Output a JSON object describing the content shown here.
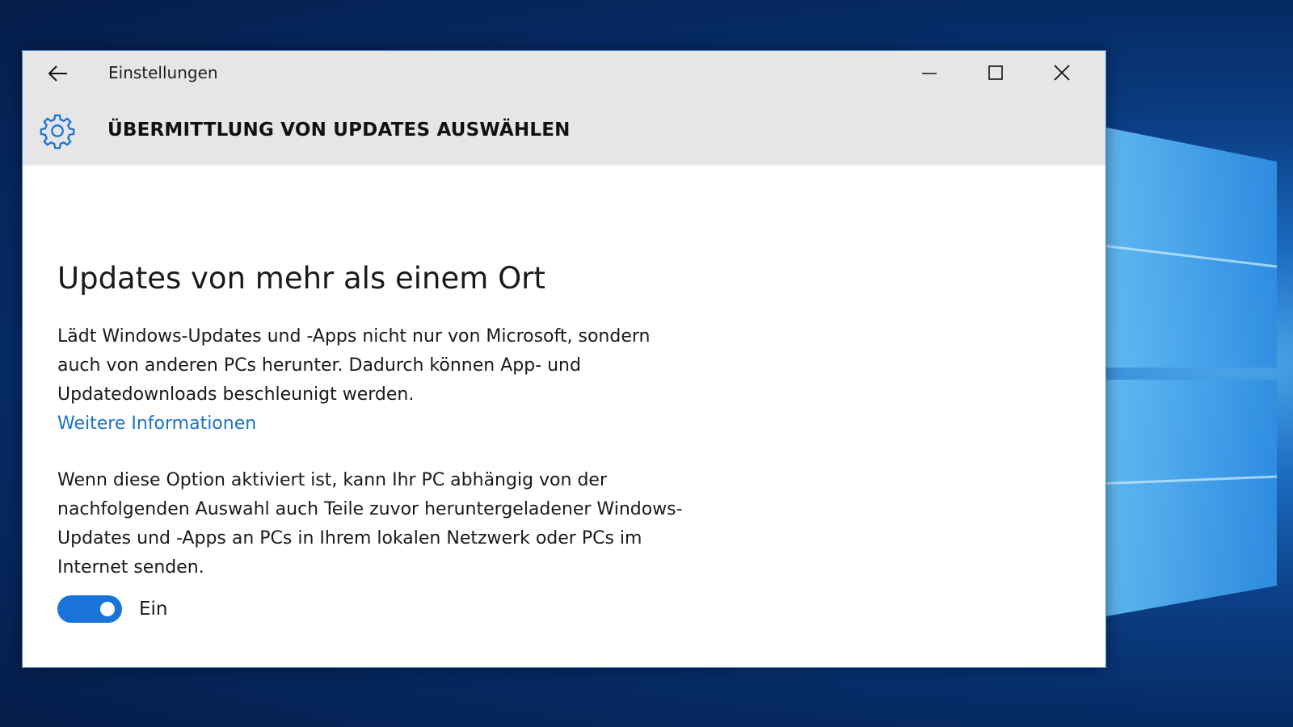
{
  "window": {
    "title": "Einstellungen",
    "page_title": "ÜBERMITTLUNG VON UPDATES AUSWÄHLEN"
  },
  "icons": {
    "back": "back-arrow-icon",
    "minimize": "minimize-icon",
    "maximize": "maximize-icon",
    "close": "close-icon",
    "settings": "gear-icon"
  },
  "content": {
    "heading": "Updates von mehr als einem Ort",
    "description": "Lädt Windows-Updates und -Apps nicht nur von Microsoft, sondern auch von anderen PCs herunter. Dadurch können App- und Updatedownloads beschleunigt werden.",
    "link": "Weitere Informationen",
    "option_text": "Wenn diese Option aktiviert ist, kann Ihr PC abhängig von der nachfolgenden Auswahl auch Teile zuvor heruntergeladener Windows-Updates und -Apps an PCs in Ihrem lokalen Netzwerk oder PCs im Internet senden.",
    "toggle_state": "Ein",
    "toggle_on": true
  },
  "colors": {
    "accent": "#1a73d9",
    "link": "#1a73c9",
    "titlebar": "#e6e6e6"
  }
}
